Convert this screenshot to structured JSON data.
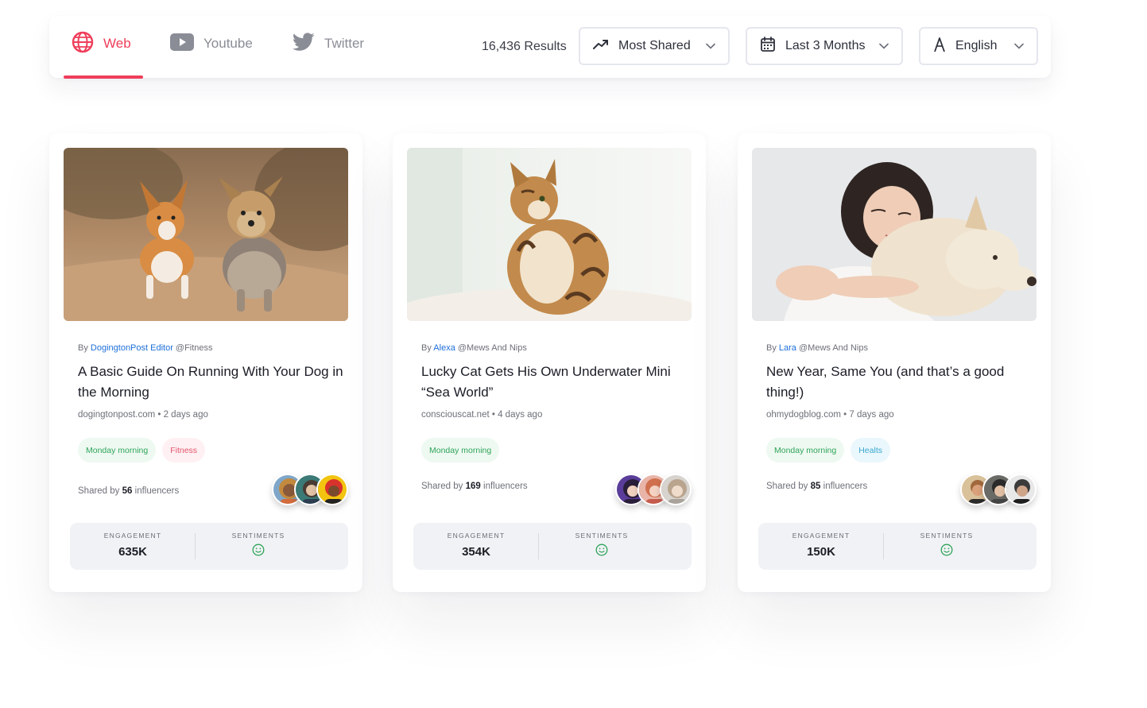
{
  "tabs": [
    {
      "label": "Web",
      "icon": "globe-icon",
      "active": true
    },
    {
      "label": "Youtube",
      "icon": "youtube-icon",
      "active": false
    },
    {
      "label": "Twitter",
      "icon": "twitter-icon",
      "active": false
    }
  ],
  "results_text": "16,436 Results",
  "filters": {
    "sort": {
      "label": "Most Shared",
      "icon": "trending-icon"
    },
    "time": {
      "label": "Last 3 Months",
      "icon": "calendar-icon"
    },
    "language": {
      "label": "English",
      "icon": "language-icon"
    }
  },
  "colors": {
    "accent": "#ef3e5a",
    "link": "#1e6fd9",
    "positive": "#2fa45a"
  },
  "cards": [
    {
      "image": "dogs running on a path",
      "by_prefix": "By",
      "author": "DogingtonPost Editor",
      "channel": "@Fitness",
      "title": "A Basic Guide On Running With Your Dog in the Morning",
      "meta": "dogingtonpost.com • 2 days ago",
      "tags": [
        {
          "label": "Monday morning",
          "style": "green"
        },
        {
          "label": "Fitness",
          "style": "pink"
        }
      ],
      "shared_prefix": "Shared by",
      "shared_count": "56",
      "shared_suffix": "influencers",
      "engagement_label": "ENGAGEMENT",
      "engagement": "635K",
      "sentiments_label": "SENTIMENTS",
      "sentiment": "smile-icon"
    },
    {
      "image": "cat sitting",
      "by_prefix": "By",
      "author": "Alexa",
      "channel": "@Mews And Nips",
      "title": "Lucky Cat Gets His Own Underwater Mini “Sea World”",
      "meta": "consciouscat.net • 4 days ago",
      "tags": [
        {
          "label": "Monday morning",
          "style": "green"
        }
      ],
      "shared_prefix": "Shared by",
      "shared_count": "169",
      "shared_suffix": "influencers",
      "engagement_label": "ENGAGEMENT",
      "engagement": "354K",
      "sentiments_label": "SENTIMENTS",
      "sentiment": "smile-icon"
    },
    {
      "image": "woman hugging dog",
      "by_prefix": "By",
      "author": "Lara",
      "channel": "@Mews And Nips",
      "title": "New Year, Same You (and that’s a good thing!)",
      "meta": "ohmydogblog.com • 7 days ago",
      "tags": [
        {
          "label": "Monday morning",
          "style": "green"
        },
        {
          "label": "Healts",
          "style": "blue"
        }
      ],
      "shared_prefix": "Shared by",
      "shared_count": "85",
      "shared_suffix": "influencers",
      "engagement_label": "ENGAGEMENT",
      "engagement": "150K",
      "sentiments_label": "SENTIMENTS",
      "sentiment": "smile-icon"
    }
  ]
}
